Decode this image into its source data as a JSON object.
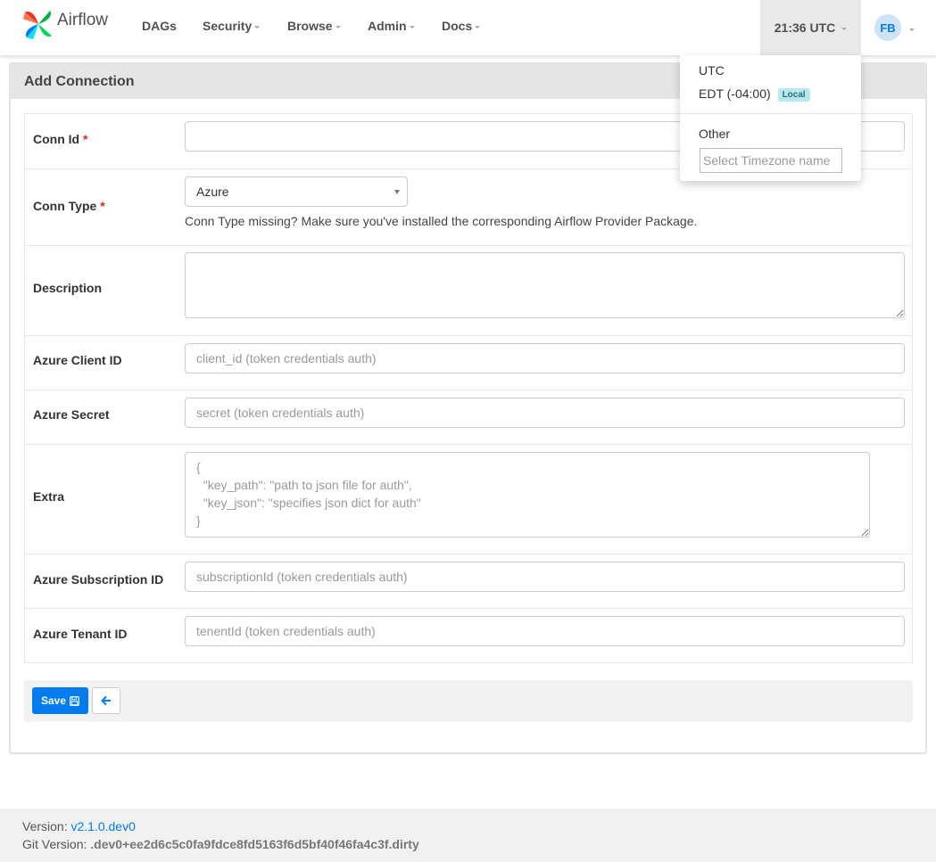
{
  "app": {
    "name": "Airflow"
  },
  "nav": {
    "items": [
      {
        "label": "DAGs",
        "dropdown": false
      },
      {
        "label": "Security",
        "dropdown": true
      },
      {
        "label": "Browse",
        "dropdown": true
      },
      {
        "label": "Admin",
        "dropdown": true
      },
      {
        "label": "Docs",
        "dropdown": true
      }
    ],
    "clock": "21:36 UTC",
    "user_initials": "FB"
  },
  "timezone_menu": {
    "utc": "UTC",
    "local": "EDT (-04:00)",
    "local_badge": "Local",
    "other": "Other",
    "search_placeholder": "Select Timezone name"
  },
  "panel": {
    "title": "Add Connection",
    "required_mark": "*",
    "fields": {
      "conn_id": {
        "label": "Conn Id",
        "value": ""
      },
      "conn_type": {
        "label": "Conn Type",
        "value": "Azure",
        "help": "Conn Type missing? Make sure you've installed the corresponding Airflow Provider Package."
      },
      "description": {
        "label": "Description",
        "value": ""
      },
      "client_id": {
        "label": "Azure Client ID",
        "placeholder": "client_id (token credentials auth)"
      },
      "secret": {
        "label": "Azure Secret",
        "placeholder": "secret (token credentials auth)"
      },
      "extra": {
        "label": "Extra",
        "placeholder": "{\n  \"key_path\": \"path to json file for auth\",\n  \"key_json\": \"specifies json dict for auth\"\n}"
      },
      "subscription_id": {
        "label": "Azure Subscription ID",
        "placeholder": "subscriptionId (token credentials auth)"
      },
      "tenant_id": {
        "label": "Azure Tenant ID",
        "placeholder": "tenentId (token credentials auth)"
      }
    },
    "save_label": "Save"
  },
  "footer": {
    "version_label": "Version:",
    "version": "v2.1.0.dev0",
    "git_label": "Git Version:",
    "git_version": ".dev0+ee2d6c5c0fa9fdce8fd5163f6d5bf40f46fa4c3f.dirty"
  },
  "colors": {
    "primary": "#017cee",
    "required": "#d9262c",
    "badge_bg": "#b7e8ef"
  },
  "icons": {
    "save": "save-icon",
    "back": "arrow-left-icon"
  }
}
